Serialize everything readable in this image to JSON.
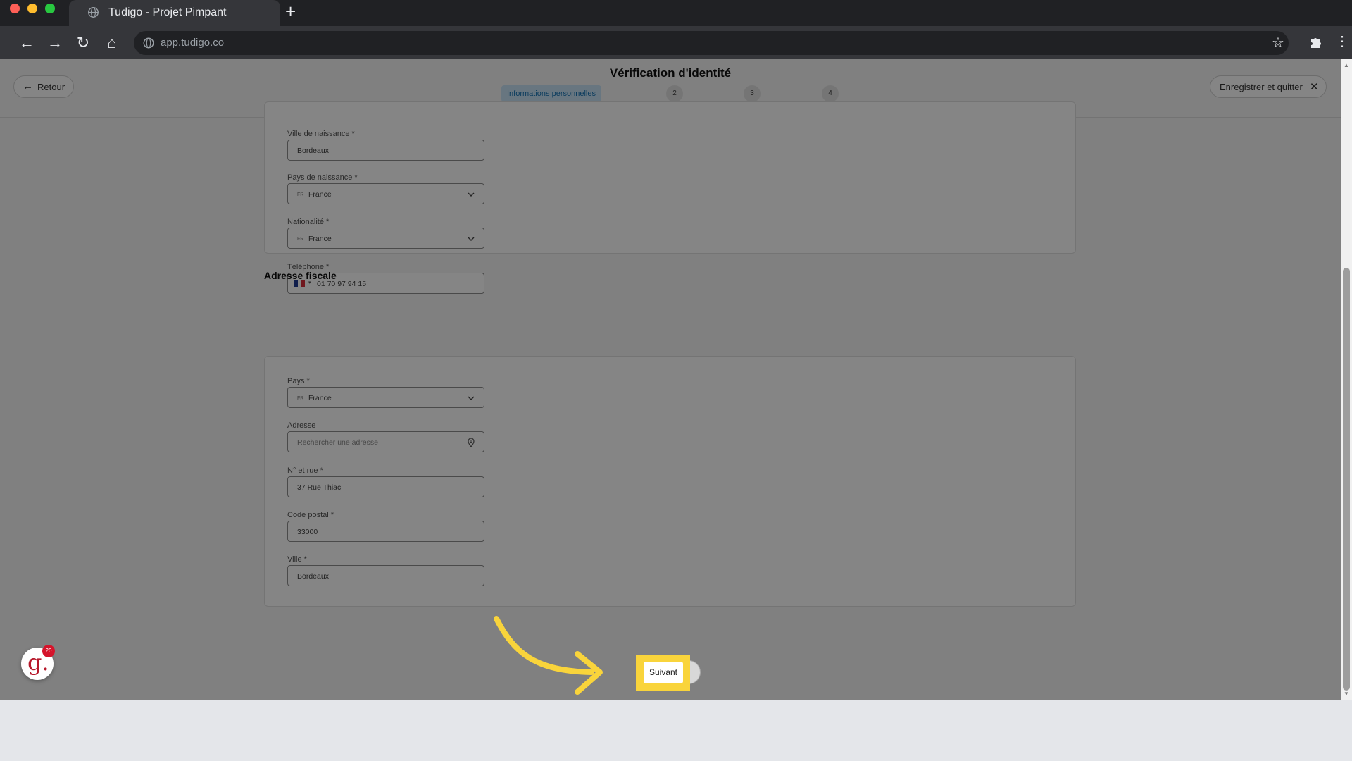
{
  "browser": {
    "tab_title": "Tudigo - Projet Pimpant",
    "new_tab_symbol": "+",
    "url": "app.tudigo.co",
    "back_symbol": "←",
    "forward_symbol": "→",
    "reload_symbol": "↻",
    "home_symbol": "⌂",
    "bookmark_symbol": "☆",
    "menu_symbol": "⋮"
  },
  "header": {
    "back_label": "Retour",
    "back_symbol": "←",
    "title": "Vérification d'identité",
    "steps": {
      "active_label": "Informations personnelles",
      "step2": "2",
      "step3": "3",
      "step4": "4"
    },
    "save_quit_label": "Enregistrer et quitter",
    "close_symbol": "✕"
  },
  "identity": {
    "birth_city": {
      "label": "Ville de naissance *",
      "value": "Bordeaux"
    },
    "birth_country": {
      "label": "Pays de naissance *",
      "flag": "FR",
      "value": "France"
    },
    "nationality": {
      "label": "Nationalité *",
      "flag": "FR",
      "value": "France"
    },
    "phone": {
      "label": "Téléphone *",
      "caret": "▾",
      "value": "01 70 97 94 15"
    }
  },
  "fiscal": {
    "section_title": "Adresse fiscale",
    "country": {
      "label": "Pays *",
      "flag": "FR",
      "value": "France"
    },
    "address": {
      "label": "Adresse",
      "placeholder": "Rechercher une adresse"
    },
    "street": {
      "label": "N° et rue *",
      "value": "37 Rue Thiac"
    },
    "postal_code": {
      "label": "Code postal *",
      "value": "33000"
    },
    "city": {
      "label": "Ville *",
      "value": "Bordeaux"
    }
  },
  "footer": {
    "logo_letter": "g.",
    "logo_badge": "20",
    "next_label": "Suivant"
  },
  "scrollbar": {
    "up": "▲",
    "down": "▼"
  },
  "colors": {
    "highlight": "#f9d43b",
    "step_active_bg": "#c8e3f5",
    "step_active_text": "#1673b5",
    "brand_red": "#b7182b"
  }
}
